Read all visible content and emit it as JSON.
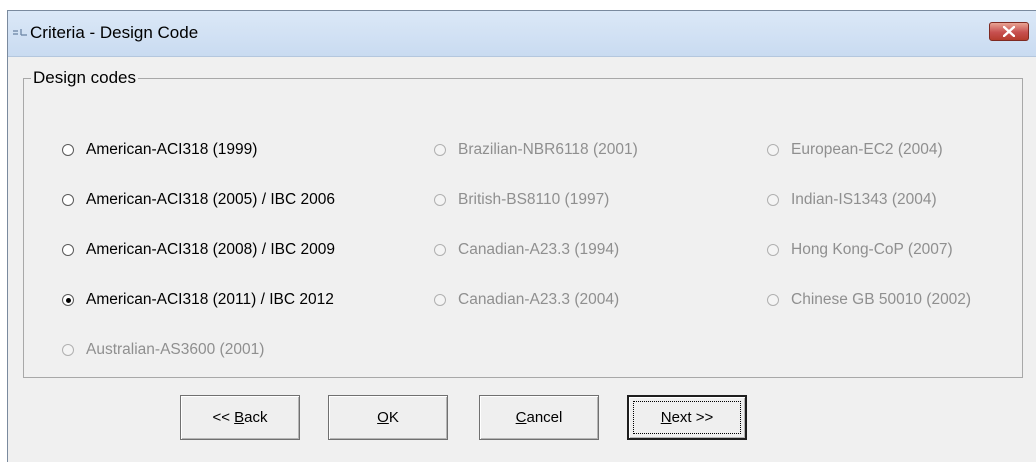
{
  "window": {
    "title": "Criteria - Design Code",
    "accent_close": "#c75050"
  },
  "group": {
    "legend": "Design codes",
    "options": [
      {
        "label": "American-ACI318 (1999)",
        "checked": false,
        "enabled": true
      },
      {
        "label": "American-ACI318 (2005) / IBC 2006",
        "checked": false,
        "enabled": true
      },
      {
        "label": "American-ACI318 (2008) / IBC 2009",
        "checked": false,
        "enabled": true
      },
      {
        "label": "American-ACI318 (2011) / IBC 2012",
        "checked": true,
        "enabled": true
      },
      {
        "label": "Australian-AS3600 (2001)",
        "checked": false,
        "enabled": false
      },
      {
        "label": "Brazilian-NBR6118 (2001)",
        "checked": false,
        "enabled": false
      },
      {
        "label": "British-BS8110 (1997)",
        "checked": false,
        "enabled": false
      },
      {
        "label": "Canadian-A23.3 (1994)",
        "checked": false,
        "enabled": false
      },
      {
        "label": "Canadian-A23.3 (2004)",
        "checked": false,
        "enabled": false
      },
      {
        "label": "European-EC2 (2004)",
        "checked": false,
        "enabled": false
      },
      {
        "label": "Indian-IS1343 (2004)",
        "checked": false,
        "enabled": false
      },
      {
        "label": "Hong Kong-CoP (2007)",
        "checked": false,
        "enabled": false
      },
      {
        "label": "Chinese GB 50010 (2002)",
        "checked": false,
        "enabled": false
      }
    ]
  },
  "buttons": {
    "back": {
      "pre": "<< ",
      "mnemonic": "B",
      "post": "ack"
    },
    "ok": {
      "pre": "",
      "mnemonic": "O",
      "post": "K"
    },
    "cancel": {
      "pre": "",
      "mnemonic": "C",
      "post": "ancel"
    },
    "next": {
      "pre": "",
      "mnemonic": "N",
      "post": "ext >>"
    }
  }
}
